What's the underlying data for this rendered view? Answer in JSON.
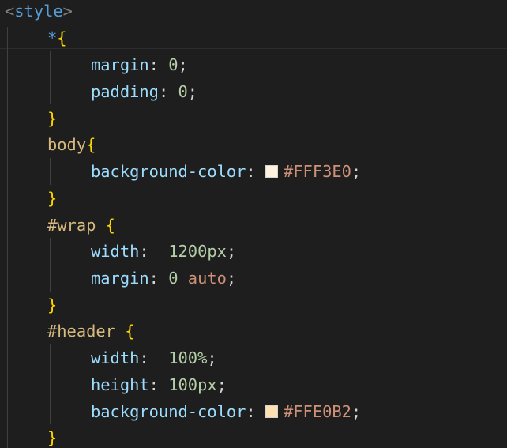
{
  "editor": {
    "lines": [
      {
        "open": "<",
        "tag": "style",
        "close": ">"
      },
      {
        "selector": "*",
        "brace": "{"
      },
      {
        "property": "margin",
        "colon": ": ",
        "value": "0",
        "semi": ";"
      },
      {
        "property": "padding",
        "colon": ": ",
        "value": "0",
        "semi": ";"
      },
      {
        "brace": "}"
      },
      {
        "selector": "body",
        "brace": "{"
      },
      {
        "property": "background-color",
        "colon": ": ",
        "value": "#FFF3E0",
        "semi": ";"
      },
      {
        "brace": "}"
      },
      {
        "selector": "#wrap",
        "brace": "{"
      },
      {
        "property": "width",
        "colon": ":  ",
        "value": "1200px",
        "semi": ";"
      },
      {
        "property": "margin",
        "colon": ": ",
        "value_num": "0",
        "value_kw": "auto",
        "semi": ";"
      },
      {
        "brace": "}"
      },
      {
        "selector": "#header",
        "brace": "{"
      },
      {
        "property": "width",
        "colon": ":  ",
        "value": "100%",
        "semi": ";"
      },
      {
        "property": "height",
        "colon": ": ",
        "value": "100px",
        "semi": ";"
      },
      {
        "property": "background-color",
        "colon": ": ",
        "value": "#FFE0B2",
        "semi": ";"
      },
      {
        "brace": "}"
      }
    ],
    "swatch_colors": [
      "#FFF3E0",
      "#FFE0B2"
    ]
  }
}
